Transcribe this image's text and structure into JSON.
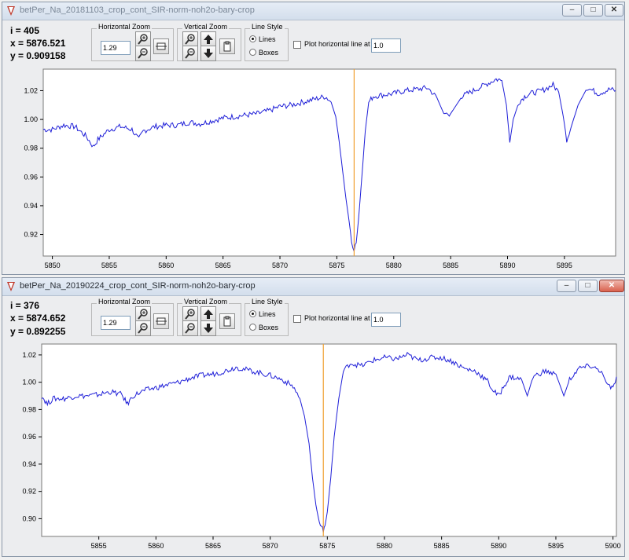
{
  "windows": [
    {
      "title": "betPer_Na_20181103_crop_cont_SIR-norm-noh2o-bary-crop",
      "readout": {
        "i": "i  = 405",
        "x": "x  = 5876.521",
        "y": "y  = 0.909158"
      },
      "horizontal_zoom": {
        "label": "Horizontal Zoom",
        "value": "1.29"
      },
      "vertical_zoom": {
        "label": "Vertical Zoom"
      },
      "line_style": {
        "label": "Line Style",
        "options": [
          "Lines",
          "Boxes"
        ],
        "selected": "Lines"
      },
      "hline": {
        "label": "Plot horizontal line at y =",
        "value": "1.0",
        "checked": false
      },
      "controls": {
        "minimize": "–",
        "maximize": "□",
        "close": "✕"
      },
      "icons": {
        "app": "app-logo-icon",
        "zoom_in": "zoom-in-icon",
        "zoom_out": "zoom-out-icon",
        "fit": "fit-width-icon",
        "up": "arrow-up-icon",
        "down": "arrow-down-icon",
        "clip": "clipboard-icon"
      },
      "chart_data": {
        "type": "line",
        "xlim": [
          5849.2,
          5899.5
        ],
        "ylim": [
          0.905,
          1.035
        ],
        "xticks": [
          5850,
          5855,
          5860,
          5865,
          5870,
          5875,
          5880,
          5885,
          5890,
          5895
        ],
        "yticks": [
          0.92,
          0.94,
          0.96,
          0.98,
          1.0,
          1.02
        ],
        "ytick_labels": [
          "0.92",
          "0.94",
          "0.96",
          "0.98",
          "1.00",
          "1.02"
        ],
        "marker_x": 5876.52,
        "line_color": "#1f1fd8",
        "marker_color": "#f0a030",
        "series": [
          {
            "x": [
              5849.2,
              5850.0,
              5851.0,
              5852.0,
              5853.0,
              5853.6,
              5854.0,
              5855.0,
              5856.0,
              5857.0,
              5857.6,
              5858.0,
              5859.0,
              5860.0,
              5861.0,
              5862.0,
              5863.0,
              5864.0,
              5865.0,
              5866.0,
              5867.0,
              5868.0,
              5869.0,
              5870.0,
              5871.0,
              5872.0,
              5873.0,
              5874.0,
              5874.5,
              5874.9,
              5875.2,
              5875.5,
              5875.8,
              5876.1,
              5876.3,
              5876.52,
              5876.7,
              5876.9,
              5877.2,
              5877.5,
              5877.8,
              5878.2,
              5879.0,
              5880.0,
              5881.0,
              5882.0,
              5883.0,
              5883.8,
              5884.4,
              5885.0,
              5886.0,
              5887.0,
              5888.0,
              5889.0,
              5889.5,
              5889.9,
              5890.2,
              5890.5,
              5891.0,
              5891.5,
              5892.0,
              5893.0,
              5894.0,
              5894.5,
              5894.9,
              5895.2,
              5895.6,
              5896.2,
              5897.0,
              5898.0,
              5899.0,
              5899.5
            ],
            "y": [
              0.993,
              0.993,
              0.996,
              0.995,
              0.988,
              0.981,
              0.986,
              0.993,
              0.995,
              0.993,
              0.986,
              0.992,
              0.995,
              0.996,
              0.996,
              0.998,
              0.997,
              0.999,
              1.001,
              1.002,
              1.003,
              1.004,
              1.006,
              1.009,
              1.01,
              1.012,
              1.014,
              1.016,
              1.012,
              1.002,
              0.985,
              0.965,
              0.945,
              0.928,
              0.915,
              0.91,
              0.914,
              0.93,
              0.96,
              0.992,
              1.012,
              1.016,
              1.017,
              1.018,
              1.02,
              1.021,
              1.022,
              1.015,
              1.004,
              1.004,
              1.016,
              1.02,
              1.024,
              1.028,
              1.027,
              1.01,
              0.984,
              1.0,
              1.012,
              1.016,
              1.018,
              1.02,
              1.024,
              1.019,
              1.002,
              0.986,
              0.995,
              1.01,
              1.022,
              1.018,
              1.021,
              1.02
            ]
          }
        ]
      }
    },
    {
      "title": "betPer_Na_20190224_crop_cont_SIR-norm-noh2o-bary-crop",
      "readout": {
        "i": "i  = 376",
        "x": "x  = 5874.652",
        "y": "y  = 0.892255"
      },
      "horizontal_zoom": {
        "label": "Horizontal Zoom",
        "value": "1.29"
      },
      "vertical_zoom": {
        "label": "Vertical Zoom"
      },
      "line_style": {
        "label": "Line Style",
        "options": [
          "Lines",
          "Boxes"
        ],
        "selected": "Lines"
      },
      "hline": {
        "label": "Plot horizontal line at y =",
        "value": "1.0",
        "checked": false
      },
      "controls": {
        "minimize": "–",
        "maximize": "□",
        "close": "✕"
      },
      "icons": {
        "app": "app-logo-icon",
        "zoom_in": "zoom-in-icon",
        "zoom_out": "zoom-out-icon",
        "fit": "fit-width-icon",
        "up": "arrow-up-icon",
        "down": "arrow-down-icon",
        "clip": "clipboard-icon"
      },
      "chart_data": {
        "type": "line",
        "xlim": [
          5850.0,
          5900.3
        ],
        "ylim": [
          0.887,
          1.028
        ],
        "xticks": [
          5855,
          5860,
          5865,
          5870,
          5875,
          5880,
          5885,
          5890,
          5895,
          5900
        ],
        "yticks": [
          0.9,
          0.92,
          0.94,
          0.96,
          0.98,
          1.0,
          1.02
        ],
        "ytick_labels": [
          "0.90",
          "0.92",
          "0.94",
          "0.96",
          "0.98",
          "1.00",
          "1.02"
        ],
        "marker_x": 5874.65,
        "line_color": "#1f1fd8",
        "marker_color": "#f0a030",
        "series": [
          {
            "x": [
              5850.0,
              5850.5,
              5851.0,
              5852.0,
              5853.0,
              5854.0,
              5855.0,
              5856.0,
              5857.0,
              5857.5,
              5858.0,
              5859.0,
              5860.0,
              5861.0,
              5862.0,
              5863.0,
              5864.0,
              5865.0,
              5866.0,
              5867.0,
              5868.0,
              5869.0,
              5870.0,
              5871.0,
              5872.0,
              5872.6,
              5873.0,
              5873.4,
              5873.7,
              5874.0,
              5874.3,
              5874.5,
              5874.65,
              5874.8,
              5875.0,
              5875.3,
              5875.6,
              5876.0,
              5876.4,
              5877.0,
              5878.0,
              5879.0,
              5880.0,
              5881.0,
              5882.0,
              5883.0,
              5884.0,
              5885.0,
              5886.0,
              5887.0,
              5888.0,
              5889.0,
              5889.5,
              5890.0,
              5890.5,
              5891.0,
              5892.0,
              5892.5,
              5893.0,
              5894.0,
              5895.0,
              5895.7,
              5896.2,
              5897.0,
              5898.0,
              5899.0,
              5899.5,
              5900.0,
              5900.3
            ],
            "y": [
              0.99,
              0.984,
              0.988,
              0.988,
              0.99,
              0.99,
              0.991,
              0.993,
              0.991,
              0.984,
              0.99,
              0.994,
              0.996,
              0.998,
              1.0,
              1.003,
              1.005,
              1.006,
              1.008,
              1.011,
              1.009,
              1.007,
              1.005,
              1.002,
              0.997,
              0.988,
              0.975,
              0.955,
              0.93,
              0.91,
              0.897,
              0.893,
              0.892,
              0.895,
              0.905,
              0.93,
              0.96,
              0.988,
              1.008,
              1.014,
              1.012,
              1.016,
              1.018,
              1.017,
              1.02,
              1.016,
              1.018,
              1.018,
              1.015,
              1.01,
              1.008,
              1.001,
              0.994,
              0.99,
              0.998,
              1.004,
              1.002,
              0.99,
              1.004,
              1.008,
              1.006,
              0.99,
              1.002,
              1.01,
              1.012,
              1.008,
              0.998,
              0.995,
              1.004
            ]
          }
        ]
      }
    }
  ]
}
